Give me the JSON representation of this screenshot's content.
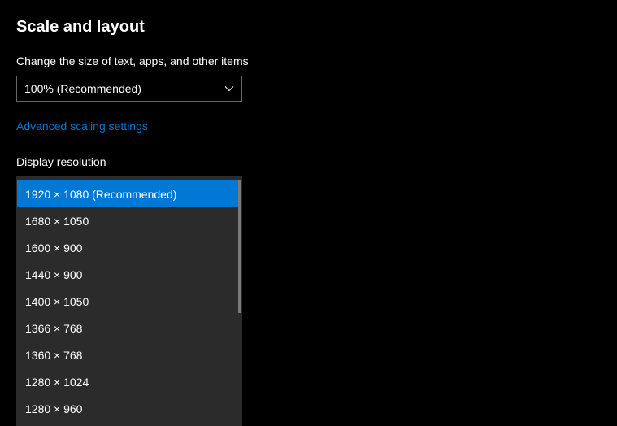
{
  "section": {
    "title": "Scale and layout"
  },
  "scale": {
    "label": "Change the size of text, apps, and other items",
    "selected": "100% (Recommended)"
  },
  "link": {
    "advanced_scaling": "Advanced scaling settings"
  },
  "resolution": {
    "label": "Display resolution",
    "selected_index": 0,
    "options": [
      "1920 × 1080 (Recommended)",
      "1680 × 1050",
      "1600 × 900",
      "1440 × 900",
      "1400 × 1050",
      "1366 × 768",
      "1360 × 768",
      "1280 × 1024",
      "1280 × 960"
    ]
  }
}
